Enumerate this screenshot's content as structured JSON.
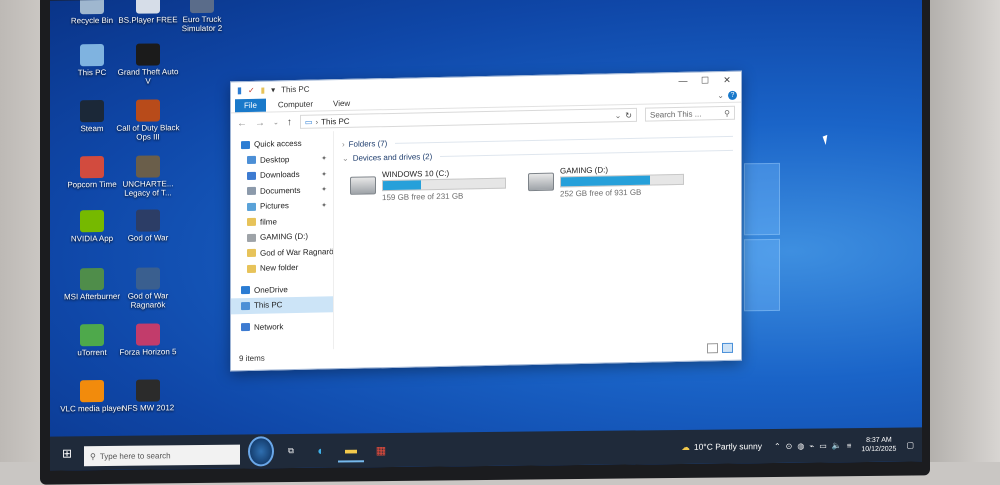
{
  "desktop": {
    "icons": [
      {
        "label": "Recycle Bin",
        "color": "#9fb7cf"
      },
      {
        "label": "BS.Player FREE",
        "color": "#d6dde8"
      },
      {
        "label": "Euro Truck Simulator 2",
        "color": "#5a6c8a"
      },
      {
        "label": "This PC",
        "color": "#7fb3e0"
      },
      {
        "label": "Grand Theft Auto V",
        "color": "#1b1b1b"
      },
      {
        "label": "Steam",
        "color": "#1b2838"
      },
      {
        "label": "Call of Duty Black Ops III",
        "color": "#b84b1a"
      },
      {
        "label": "Popcorn Time",
        "color": "#d24b3e"
      },
      {
        "label": "UNCHARTE... Legacy of T...",
        "color": "#6a5e4a"
      },
      {
        "label": "NVIDIA App",
        "color": "#76b900"
      },
      {
        "label": "God of War",
        "color": "#2c3d66"
      },
      {
        "label": "MSI Afterburner",
        "color": "#4f8d4a"
      },
      {
        "label": "God of War Ragnarök",
        "color": "#3a5f8f"
      },
      {
        "label": "uTorrent",
        "color": "#4ea94b"
      },
      {
        "label": "Forza Horizon 5",
        "color": "#c23c6b"
      },
      {
        "label": "VLC media player",
        "color": "#f28b0c"
      },
      {
        "label": "NFS MW 2012",
        "color": "#2b2b2b"
      }
    ]
  },
  "explorer": {
    "title": "This PC",
    "ribbon": {
      "file": "File",
      "computer": "Computer",
      "view": "View"
    },
    "address": "This PC",
    "search_placeholder": "Search This ...",
    "nav": [
      {
        "label": "Quick access",
        "icon": "star-icon",
        "color": "#2b7cd3",
        "sub": false,
        "pinned": false
      },
      {
        "label": "Desktop",
        "icon": "folder-icon",
        "color": "#4c8fd6",
        "sub": true,
        "pinned": true
      },
      {
        "label": "Downloads",
        "icon": "download-folder-icon",
        "color": "#3d7bd1",
        "sub": true,
        "pinned": true
      },
      {
        "label": "Documents",
        "icon": "document-folder-icon",
        "color": "#8c9aab",
        "sub": true,
        "pinned": true
      },
      {
        "label": "Pictures",
        "icon": "pictures-folder-icon",
        "color": "#5aa2d8",
        "sub": true,
        "pinned": true
      },
      {
        "label": "filme",
        "icon": "folder-icon",
        "color": "#e7c35a",
        "sub": true,
        "pinned": false
      },
      {
        "label": "GAMING (D:)",
        "icon": "drive-icon",
        "color": "#9ea3a8",
        "sub": true,
        "pinned": false
      },
      {
        "label": "God of War Ragnarö",
        "icon": "folder-icon",
        "color": "#e7c35a",
        "sub": true,
        "pinned": false
      },
      {
        "label": "New folder",
        "icon": "folder-icon",
        "color": "#e7c35a",
        "sub": true,
        "pinned": false
      },
      {
        "label": "OneDrive",
        "icon": "cloud-icon",
        "color": "#2b7cd3",
        "sub": false,
        "pinned": false
      },
      {
        "label": "This PC",
        "icon": "computer-icon",
        "color": "#4c8fd6",
        "sub": false,
        "pinned": false,
        "selected": true
      },
      {
        "label": "Network",
        "icon": "network-icon",
        "color": "#3d7bd1",
        "sub": false,
        "pinned": false
      }
    ],
    "folders_header": "Folders (7)",
    "drives_header": "Devices and drives (2)",
    "drives": [
      {
        "name": "WINDOWS 10 (C:)",
        "free": "159 GB free of 231 GB",
        "used_fraction": 0.31
      },
      {
        "name": "GAMING (D:)",
        "free": "252 GB free of 931 GB",
        "used_fraction": 0.73
      }
    ],
    "status": "9 items"
  },
  "taskbar": {
    "search_placeholder": "Type here to search",
    "weather": "10°C  Partly sunny",
    "time": "8:37 AM",
    "date": "10/12/2025"
  },
  "colors": {
    "accent": "#1979ca",
    "progress": "#26a0da",
    "desktop": "#1a64c8"
  }
}
